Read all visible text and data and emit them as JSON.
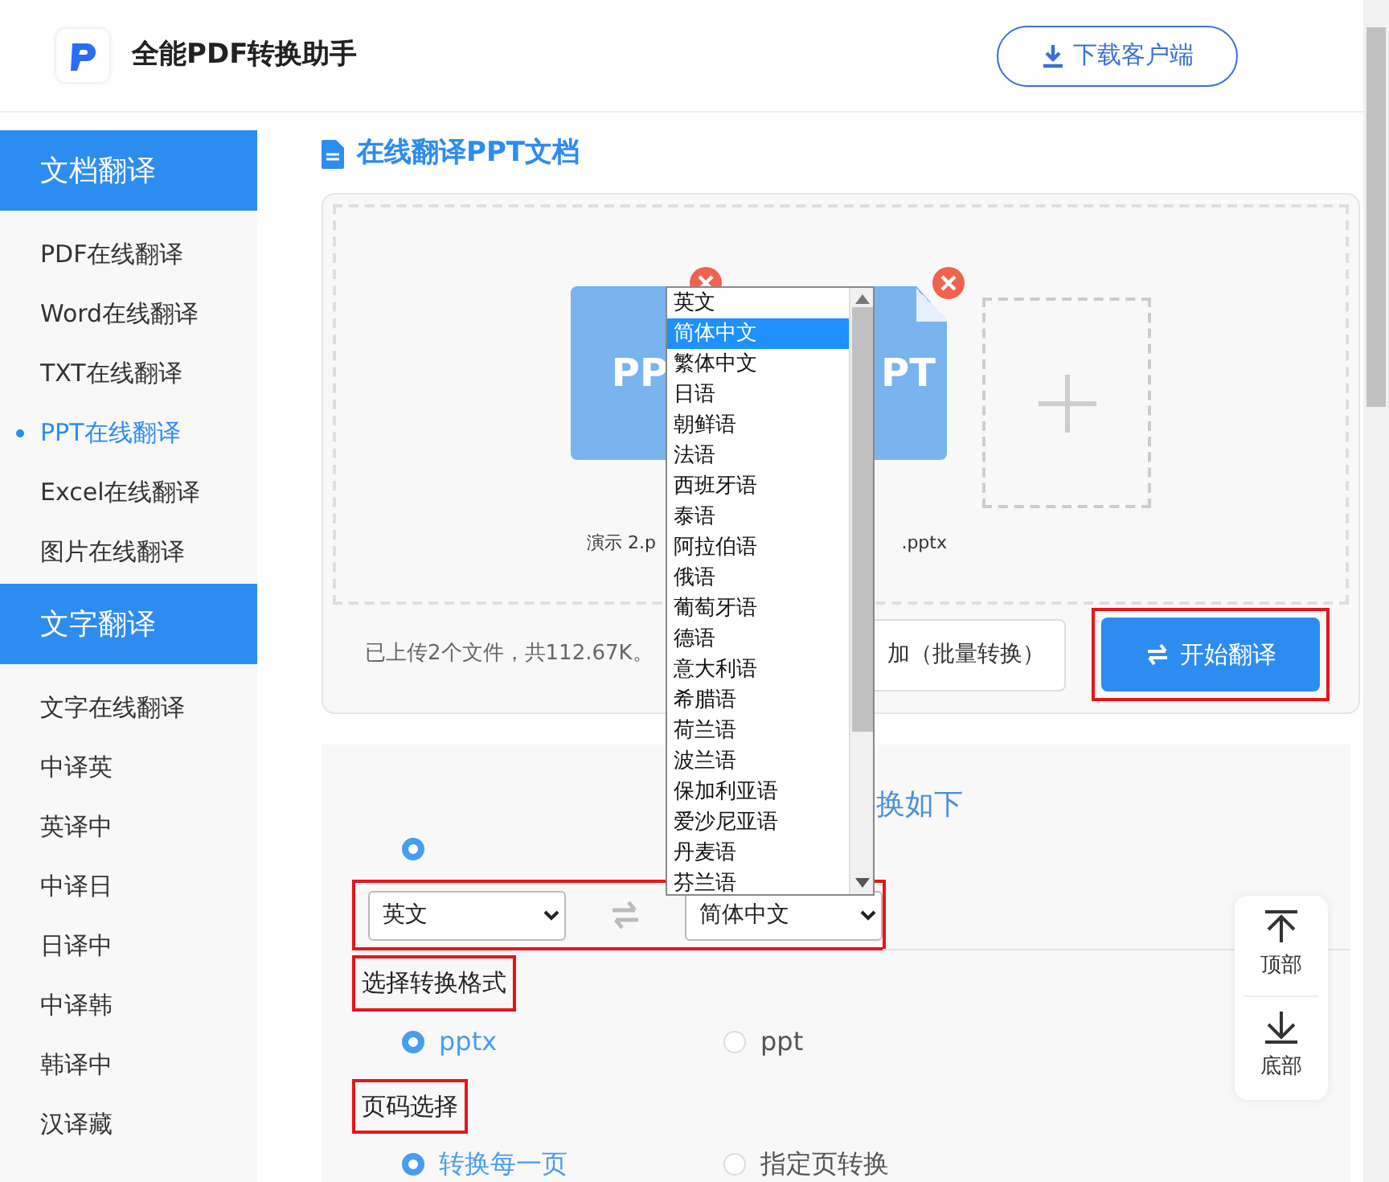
{
  "header": {
    "app_name": "全能PDF转换助手",
    "download_button": "下载客户端"
  },
  "sidebar": {
    "sections": [
      {
        "title": "文档翻译",
        "items": [
          {
            "label": "PDF在线翻译",
            "selected": false
          },
          {
            "label": "Word在线翻译",
            "selected": false
          },
          {
            "label": "TXT在线翻译",
            "selected": false
          },
          {
            "label": "PPT在线翻译",
            "selected": true
          },
          {
            "label": "Excel在线翻译",
            "selected": false
          },
          {
            "label": "图片在线翻译",
            "selected": false
          }
        ]
      },
      {
        "title": "文字翻译",
        "items": [
          {
            "label": "文字在线翻译",
            "selected": false
          },
          {
            "label": "中译英",
            "selected": false
          },
          {
            "label": "英译中",
            "selected": false
          },
          {
            "label": "中译日",
            "selected": false
          },
          {
            "label": "日译中",
            "selected": false
          },
          {
            "label": "中译韩",
            "selected": false
          },
          {
            "label": "韩译中",
            "selected": false
          },
          {
            "label": "汉译藏",
            "selected": false
          }
        ]
      }
    ]
  },
  "page_title": "在线翻译PPT文档",
  "upload": {
    "files": [
      {
        "icon_text": "PP",
        "name": "演示 2.p"
      },
      {
        "icon_text": "PT",
        "name": ".pptx"
      }
    ],
    "summary": "已上传2个文件，共112.67K。",
    "add_button": "加（批量转换）",
    "start_button": {
      "label": "开始翻译",
      "highlighted": true
    }
  },
  "options": {
    "heading": "换如下",
    "mode_radio": {
      "selected": true
    },
    "language_row": {
      "highlighted": true,
      "source": "英文",
      "target": "简体中文"
    },
    "format": {
      "title": "选择转换格式",
      "highlighted": true,
      "options": [
        {
          "label": "pptx",
          "selected": true
        },
        {
          "label": "ppt",
          "selected": false
        }
      ]
    },
    "pages": {
      "title": "页码选择",
      "highlighted": true,
      "options": [
        {
          "label": "转换每一页",
          "selected": true
        },
        {
          "label": "指定页转换",
          "selected": false
        }
      ]
    }
  },
  "language_dropdown": {
    "items": [
      {
        "label": "英文",
        "selected": false
      },
      {
        "label": "简体中文",
        "selected": true
      },
      {
        "label": "繁体中文",
        "selected": false
      },
      {
        "label": "日语",
        "selected": false
      },
      {
        "label": "朝鲜语",
        "selected": false
      },
      {
        "label": "法语",
        "selected": false
      },
      {
        "label": "西班牙语",
        "selected": false
      },
      {
        "label": "泰语",
        "selected": false
      },
      {
        "label": "阿拉伯语",
        "selected": false
      },
      {
        "label": "俄语",
        "selected": false
      },
      {
        "label": "葡萄牙语",
        "selected": false
      },
      {
        "label": "德语",
        "selected": false
      },
      {
        "label": "意大利语",
        "selected": false
      },
      {
        "label": "希腊语",
        "selected": false
      },
      {
        "label": "荷兰语",
        "selected": false
      },
      {
        "label": "波兰语",
        "selected": false
      },
      {
        "label": "保加利亚语",
        "selected": false
      },
      {
        "label": "爱沙尼亚语",
        "selected": false
      },
      {
        "label": "丹麦语",
        "selected": false
      },
      {
        "label": "芬兰语",
        "selected": false
      }
    ]
  },
  "float_nav": [
    {
      "kind": "up",
      "label": "顶部"
    },
    {
      "kind": "down",
      "label": "底部"
    }
  ]
}
